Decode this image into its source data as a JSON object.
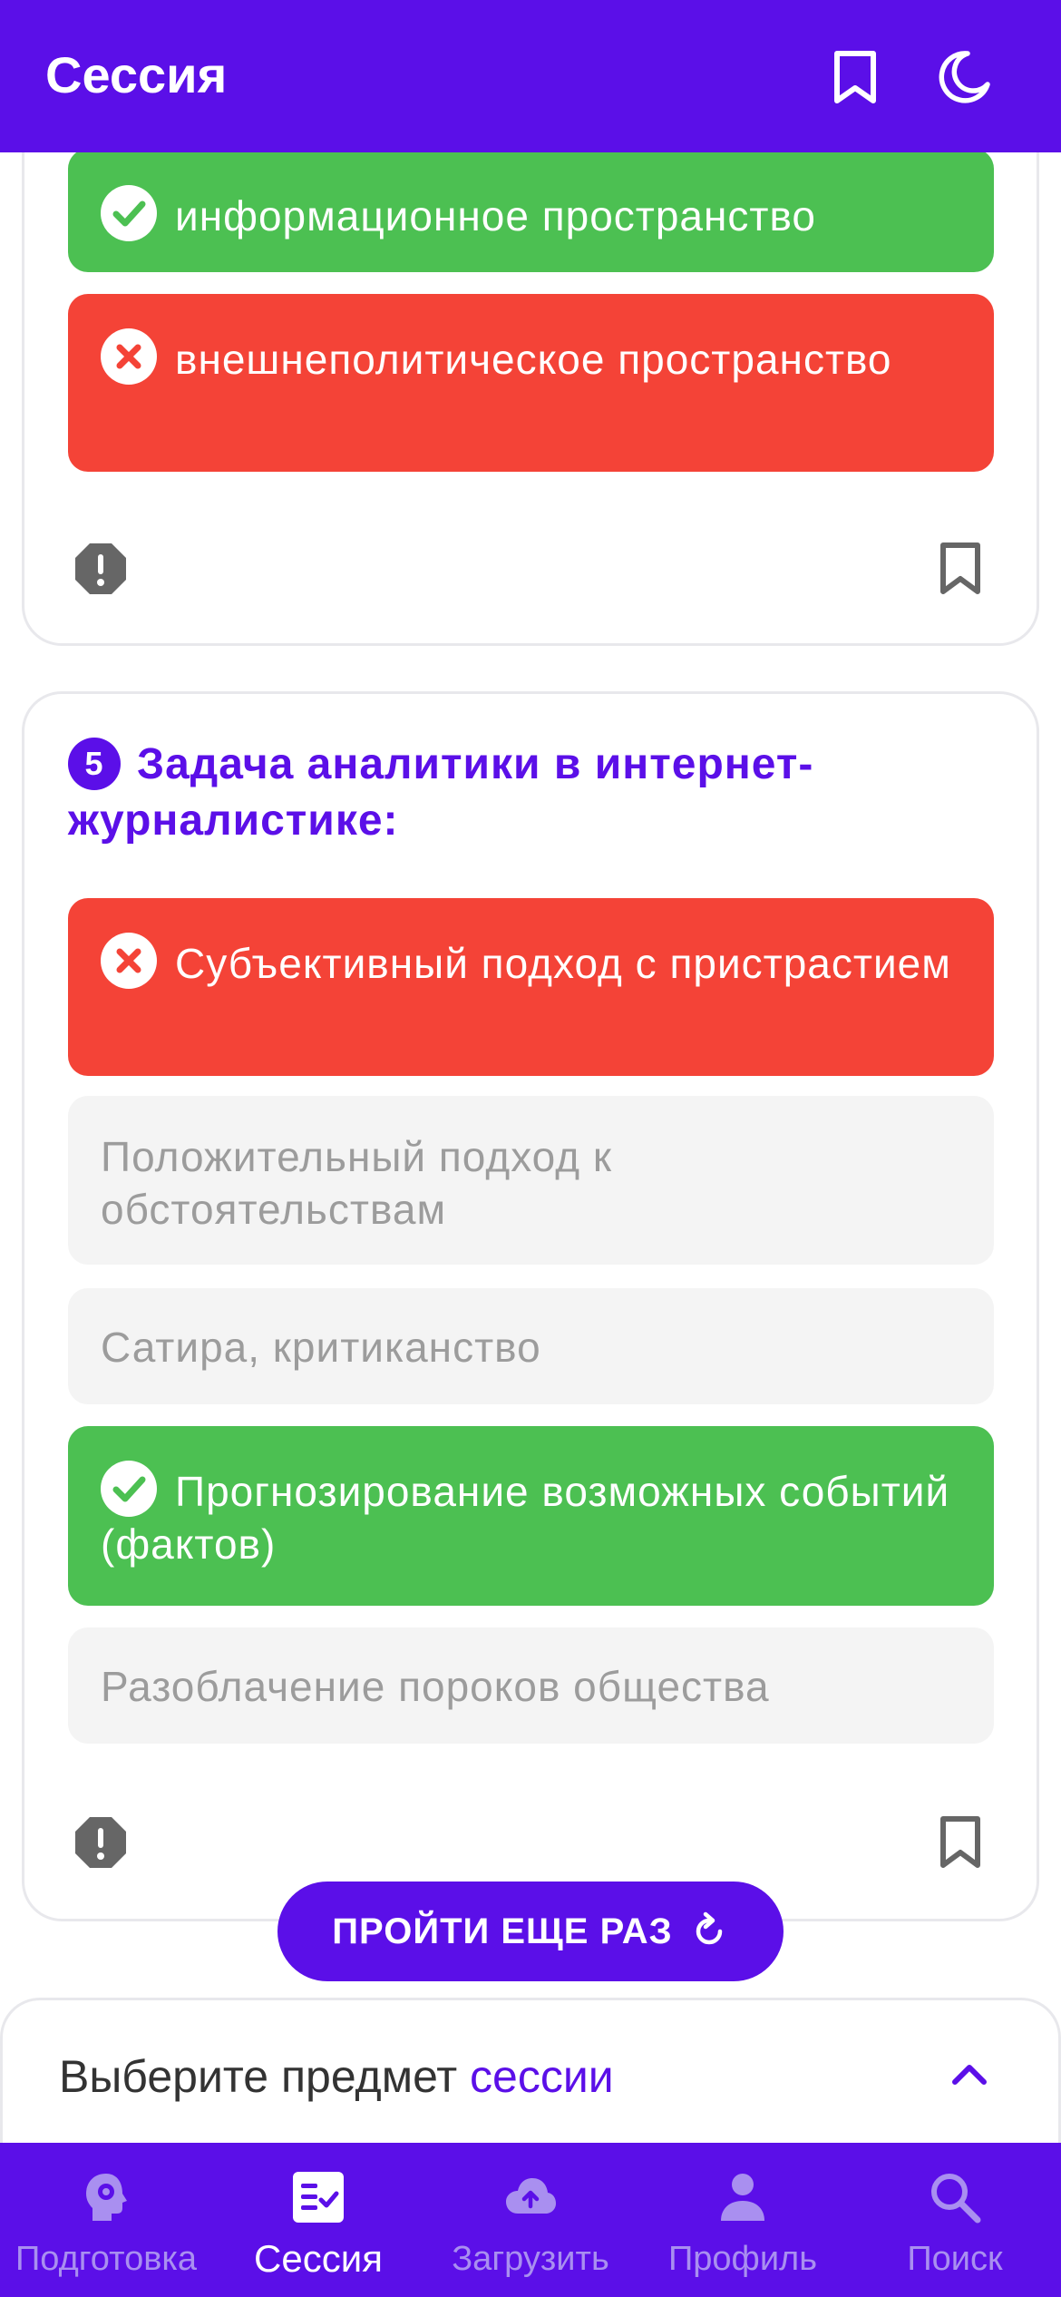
{
  "header": {
    "title": "Сессия"
  },
  "prev_question": {
    "options": [
      {
        "text": "информационное пространство",
        "state": "correct"
      },
      {
        "text": "внешнеполитическое пространство",
        "state": "wrong"
      }
    ]
  },
  "question": {
    "number": "5",
    "title": "Задача аналитики в интернет-журналистике:",
    "options": [
      {
        "text": "Субъективный подход с пристрастием",
        "state": "wrong"
      },
      {
        "text": "Положительный подход к обстоятельствам",
        "state": "neutral"
      },
      {
        "text": "Сатира, критиканство",
        "state": "neutral"
      },
      {
        "text": "Прогнозирование возможных событий (фактов)",
        "state": "correct"
      },
      {
        "text": "Разоблачение пороков общества",
        "state": "neutral"
      }
    ]
  },
  "retry_button": {
    "label": "ПРОЙТИ ЕЩЕ РАЗ"
  },
  "subject_picker": {
    "label_prefix": "Выберите предмет ",
    "label_accent": "сессии"
  },
  "nav": {
    "items": [
      {
        "label": "Подготовка",
        "icon": "brain-gear-icon",
        "active": false
      },
      {
        "label": "Сессия",
        "icon": "checklist-icon",
        "active": true
      },
      {
        "label": "Загрузить",
        "icon": "cloud-upload-icon",
        "active": false
      },
      {
        "label": "Профиль",
        "icon": "person-icon",
        "active": false
      },
      {
        "label": "Поиск",
        "icon": "search-icon",
        "active": false
      }
    ]
  },
  "colors": {
    "accent": "#5b0fe8",
    "correct": "#4cc052",
    "wrong": "#f44337",
    "neutral_bg": "#f4f4f4"
  }
}
